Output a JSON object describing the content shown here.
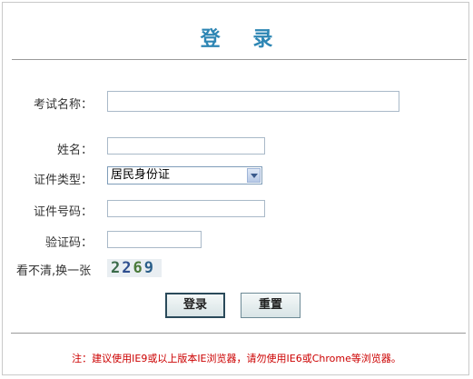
{
  "title": "登 录",
  "form": {
    "exam_name_label": "考试名称：",
    "exam_name_value": "",
    "name_label": "姓名：",
    "name_value": "",
    "id_type_label": "证件类型：",
    "id_type_selected": "居民身份证",
    "id_number_label": "证件号码：",
    "id_number_value": "",
    "captcha_label": "验证码：",
    "captcha_value": "",
    "captcha_refresh_label": "看不清,换一张",
    "captcha_digits": [
      "2",
      "2",
      "6",
      "9"
    ]
  },
  "buttons": {
    "login_label": "登录",
    "reset_label": "重置"
  },
  "note": "注：建议使用IE9或以上版本IE浏览器，请勿使用IE6或Chrome等浏览器。",
  "colors": {
    "title": "#2e86b4",
    "note": "#cc0000"
  },
  "icons": {
    "select_arrow": "chevron-down-icon"
  }
}
